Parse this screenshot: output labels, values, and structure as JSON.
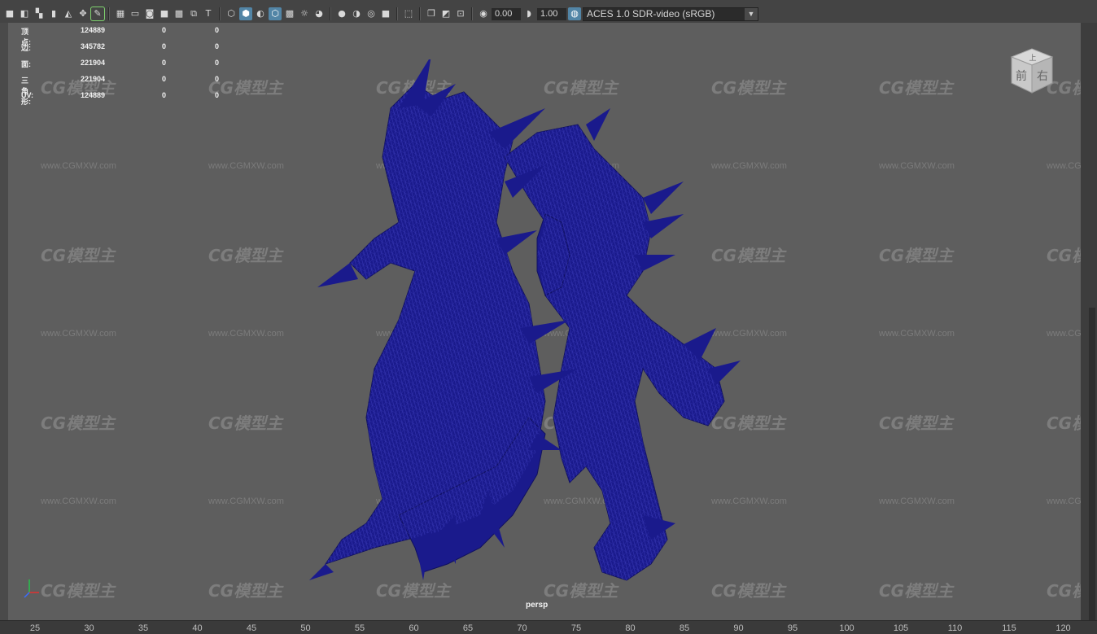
{
  "toolbar": {
    "exposure_value": "0.00",
    "gamma_value": "1.00",
    "color_management_label": "ACES 1.0 SDR-video (sRGB)",
    "icons": [
      "camera-select-icon",
      "camera-attributes-icon",
      "bookmark-icon",
      "image-plane-icon",
      "2d-pan-zoom-icon",
      "grease-pencil-icon",
      "grid-icon",
      "film-gate-icon",
      "resolution-gate-icon",
      "gate-mask-icon",
      "field-chart-icon",
      "safe-action-icon",
      "safe-title-icon",
      "wireframe-icon",
      "smooth-shade-icon",
      "wireframe-on-shaded-icon",
      "textured-icon",
      "use-all-lights-icon",
      "shadows-icon",
      "screen-space-ao-icon",
      "motion-blur-icon",
      "anti-aliasing-icon",
      "depth-of-field-icon",
      "isolate-select-icon",
      "xray-icon",
      "xray-joints-icon",
      "xray-active-components-icon",
      "exposure-icon",
      "gamma-icon",
      "color-management-icon"
    ]
  },
  "hud": {
    "rows": [
      {
        "label": "顶点:",
        "v1": "124889",
        "v2": "0",
        "v3": "0"
      },
      {
        "label": "边:",
        "v1": "345782",
        "v2": "0",
        "v3": "0"
      },
      {
        "label": "面:",
        "v1": "221904",
        "v2": "0",
        "v3": "0"
      },
      {
        "label": "三角形:",
        "v1": "221904",
        "v2": "0",
        "v3": "0"
      },
      {
        "label": "UV:",
        "v1": "124889",
        "v2": "0",
        "v3": "0"
      }
    ]
  },
  "viewcube": {
    "face_front": "前",
    "face_right": "右",
    "face_top": "上"
  },
  "watermark": {
    "logo": "CG模型主",
    "url": "www.CGMXW.com"
  },
  "camera_label": "persp",
  "ruler": {
    "ticks": [
      "25",
      "30",
      "35",
      "40",
      "45",
      "50",
      "55",
      "60",
      "65",
      "70",
      "75",
      "80",
      "85",
      "90",
      "95",
      "100",
      "105",
      "110",
      "115",
      "120"
    ]
  },
  "colors": {
    "wireframe": "#1a1a8c",
    "active_icon": "#5285a6",
    "viewport_bg": "#5e5e5e"
  }
}
